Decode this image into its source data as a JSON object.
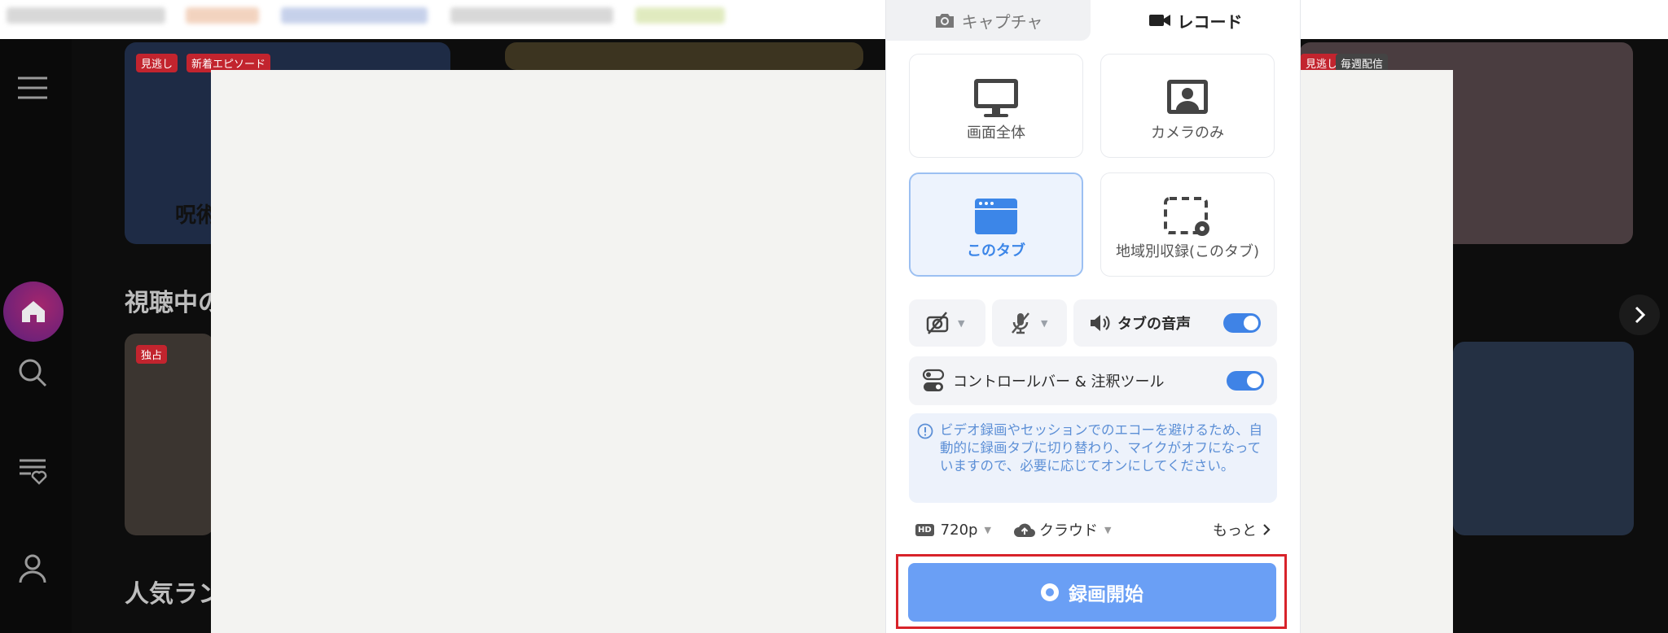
{
  "popup": {
    "tabs": [
      {
        "label": "キャプチャ",
        "icon": "camera-icon"
      },
      {
        "label": "レコード",
        "icon": "video-camera-icon"
      }
    ],
    "modes": [
      {
        "label": "画面全体",
        "icon": "monitor-icon"
      },
      {
        "label": "カメラのみ",
        "icon": "camera-portrait-icon"
      },
      {
        "label": "このタブ",
        "icon": "browser-tab-icon",
        "selected": true
      },
      {
        "label": "地域別収録(このタブ)",
        "icon": "region-select-icon"
      }
    ],
    "audio": {
      "tab_audio_label": "タブの音声",
      "tab_audio_on": true
    },
    "controlbar": {
      "label": "コントロールバー & 注釈ツール",
      "on": true
    },
    "notice": "ビデオ録画やセッションでのエコーを避けるため、自動的に録画タブに切り替わり、マイクがオフになっていますので、必要に応じてオンにしてください。",
    "quality": {
      "badge": "HD",
      "value": "720p"
    },
    "storage": {
      "value": "クラウド"
    },
    "more_label": "もっと",
    "start_label": "録画開始",
    "accent_color": "#3f83e6",
    "start_color": "#6a9ff5",
    "highlight_color": "#d8232a"
  },
  "background": {
    "badges": [
      "見逃し",
      "新着エピソード",
      "独占",
      "見逃し",
      "毎週配信"
    ],
    "row_titles": [
      "視聴中の",
      "人気ラン"
    ],
    "partial_title": "呪術"
  }
}
